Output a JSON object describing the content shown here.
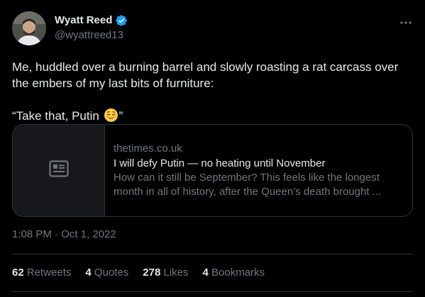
{
  "author": {
    "display_name": "Wyatt Reed",
    "handle": "@wyattreed13",
    "verified_icon": "verified-badge-icon",
    "accent_color": "#1d9bf0"
  },
  "menu": {
    "icon": "more-horizontal-icon"
  },
  "tweet": {
    "line1": "Me, huddled over a burning barrel and slowly roasting a rat carcass over the embers of my last bits of furniture:",
    "line2_prefix": "“Take that, Putin ",
    "line2_emoji": "relieved-face-emoji",
    "line2_suffix": "”"
  },
  "link_card": {
    "thumbnail_icon": "article-icon",
    "domain": "thetimes.co.uk",
    "title": "I will defy Putin — no heating until November",
    "description_line1": "How can it still be September? This feels like the longest",
    "description_line2": "month in all of history, after the Queen’s death brought ..."
  },
  "timestamp": "1:08 PM · Oct 1, 2022",
  "stats": [
    {
      "count": "62",
      "label": "Retweets"
    },
    {
      "count": "4",
      "label": "Quotes"
    },
    {
      "count": "278",
      "label": "Likes"
    },
    {
      "count": "4",
      "label": "Bookmarks"
    }
  ]
}
